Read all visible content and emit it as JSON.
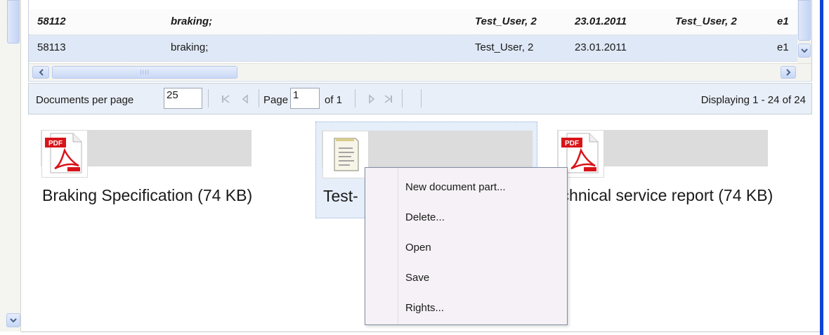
{
  "grid": {
    "rows": [
      {
        "id": "58112",
        "name": "braking;",
        "user": "Test_User, 2",
        "date": "23.01.2011",
        "user2": "Test_User, 2",
        "ext": "e1"
      },
      {
        "id": "58113",
        "name": "braking;",
        "user": "Test_User, 2",
        "date": "23.01.2011",
        "user2": "",
        "ext": "e1"
      }
    ],
    "hscroll_grip": "IIII"
  },
  "pager": {
    "per_page_label": "Documents per page",
    "per_page_value": "25",
    "page_label": "Page",
    "page_value": "1",
    "of_label": "of 1",
    "display_text": "Displaying 1 - 24 of 24"
  },
  "documents": [
    {
      "title": "Braking Specification (74 KB)",
      "icon": "pdf-icon"
    },
    {
      "title": "Test-",
      "icon": "text-document-icon"
    },
    {
      "title": "echnical service report (74 KB)",
      "icon": "pdf-icon"
    }
  ],
  "context_menu": {
    "items": [
      "New document part...",
      "Delete...",
      "Open",
      "Save",
      "Rights..."
    ]
  },
  "colors": {
    "accent": "#1143d6",
    "selection": "#dfe8f6",
    "pdf_red": "#d8141a"
  }
}
